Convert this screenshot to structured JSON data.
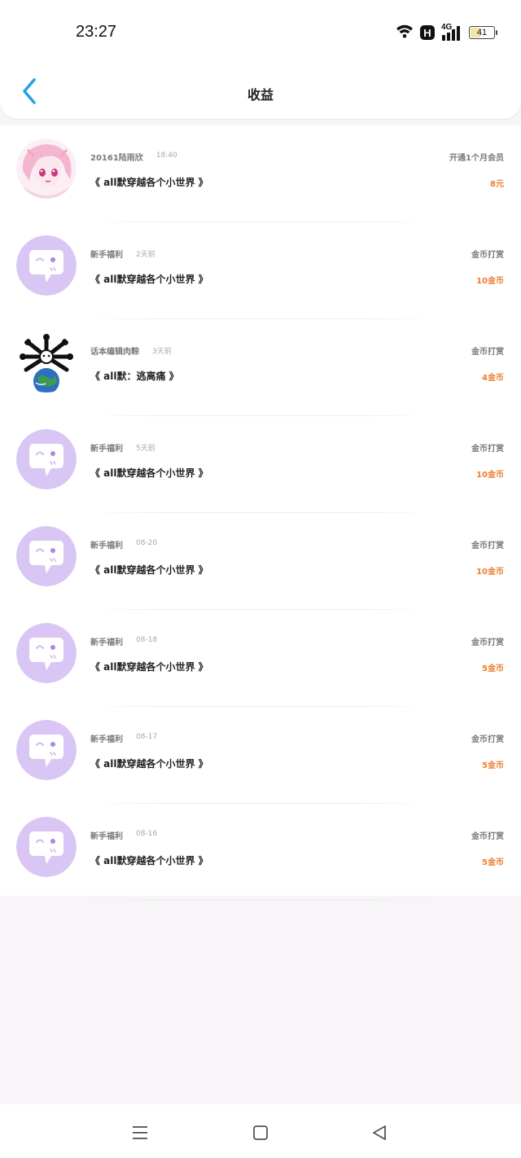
{
  "status_bar": {
    "time": "23:27",
    "network": "4G",
    "battery": "41",
    "icons": [
      "wifi-icon",
      "h-badge-icon",
      "signal-icon",
      "battery-icon"
    ]
  },
  "header": {
    "title": "收益",
    "back_icon": "chevron-left-icon"
  },
  "colors": {
    "accent_back": "#2a9fe0",
    "amount": "#ef7d2f",
    "avatar_purple": "#d9c6f5"
  },
  "records": [
    {
      "name": "20161陆雨欣",
      "time": "18:40",
      "book": "《 all默穿越各个小世界 》",
      "type": "开通1个月会员",
      "amount": "8元",
      "avatar": "anime-girl"
    },
    {
      "name": "新手福利",
      "time": "2天前",
      "book": "《 all默穿越各个小世界 》",
      "type": "金币打赏",
      "amount": "10金币",
      "avatar": "chat-bubble"
    },
    {
      "name": "话本编辑肉粽",
      "time": "3天前",
      "book": "《 all默：逃离痛 》",
      "type": "金币打赏",
      "amount": "4金币",
      "avatar": "earth-bones"
    },
    {
      "name": "新手福利",
      "time": "5天前",
      "book": "《 all默穿越各个小世界 》",
      "type": "金币打赏",
      "amount": "10金币",
      "avatar": "chat-bubble"
    },
    {
      "name": "新手福利",
      "time": "08-20",
      "book": "《 all默穿越各个小世界 》",
      "type": "金币打赏",
      "amount": "10金币",
      "avatar": "chat-bubble"
    },
    {
      "name": "新手福利",
      "time": "08-18",
      "book": "《 all默穿越各个小世界 》",
      "type": "金币打赏",
      "amount": "5金币",
      "avatar": "chat-bubble"
    },
    {
      "name": "新手福利",
      "time": "08-17",
      "book": "《 all默穿越各个小世界 》",
      "type": "金币打赏",
      "amount": "5金币",
      "avatar": "chat-bubble"
    },
    {
      "name": "新手福利",
      "time": "08-16",
      "book": "《 all默穿越各个小世界 》",
      "type": "金币打赏",
      "amount": "5金币",
      "avatar": "chat-bubble"
    }
  ],
  "nav": {
    "icons": [
      "menu-icon",
      "home-square-icon",
      "back-triangle-icon"
    ]
  }
}
